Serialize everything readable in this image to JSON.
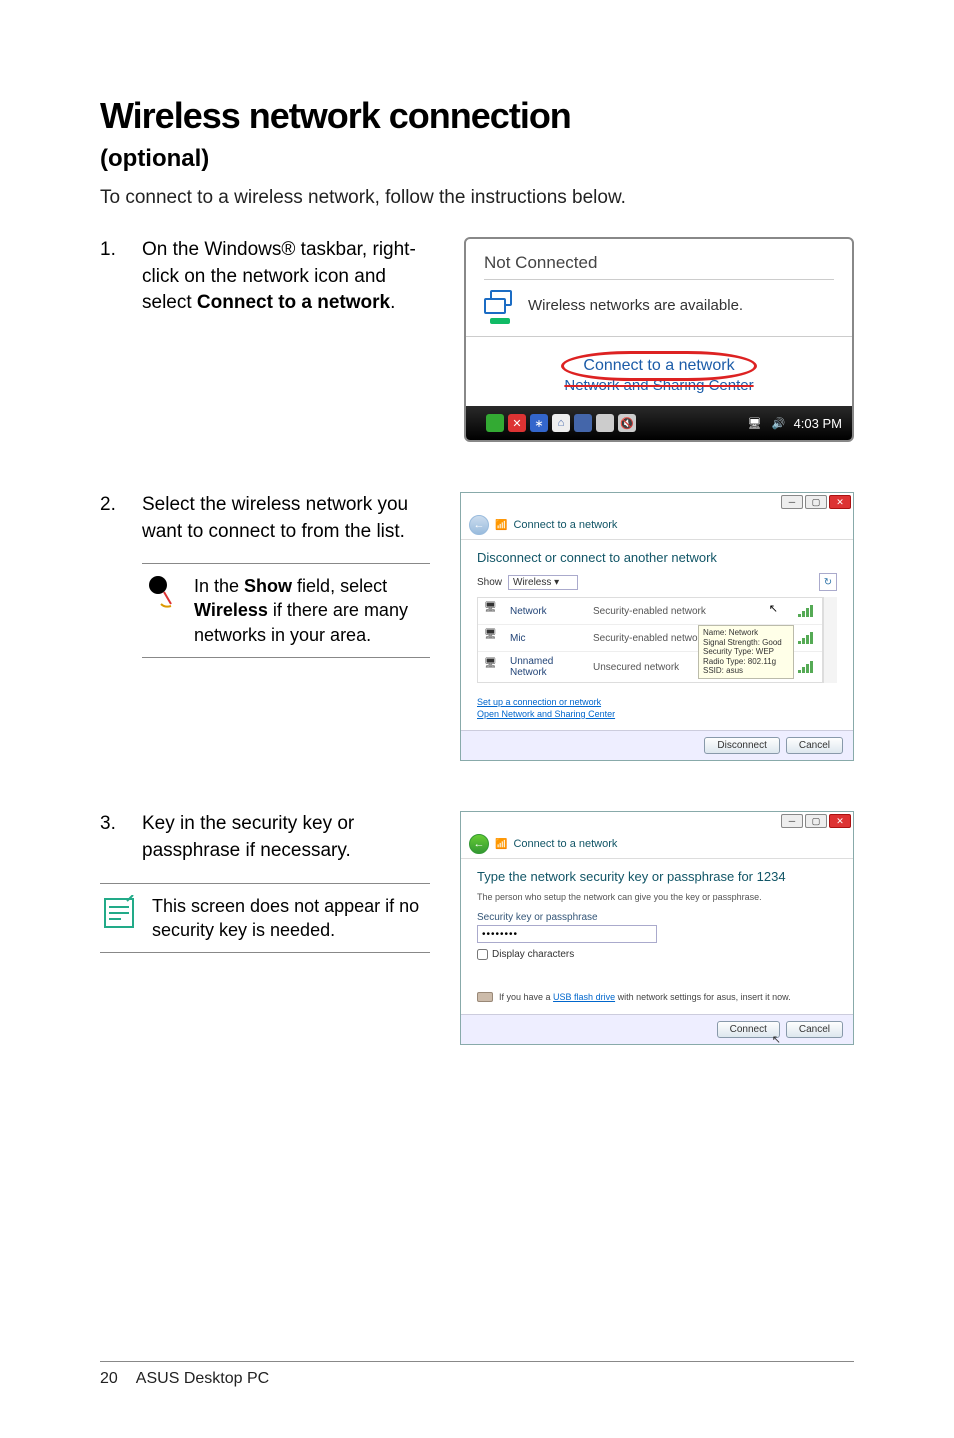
{
  "title": "Wireless network connection",
  "subtitle": "(optional)",
  "intro": "To connect to a wireless network, follow the instructions below.",
  "steps": [
    {
      "num": "1.",
      "text_parts": [
        "On the Windows® taskbar, right-click on the network icon and select ",
        "Connect to a network",
        "."
      ]
    },
    {
      "num": "2.",
      "text": "Select the wireless network you want to connect to from the list.",
      "note_parts": [
        "In the ",
        "Show",
        " field, select ",
        "Wireless",
        " if there are many networks in your area."
      ]
    },
    {
      "num": "3.",
      "text": "Key in the security key or passphrase if necessary.",
      "note": "This screen does not appear if no security key is needed."
    }
  ],
  "shot1": {
    "title": "Not Connected",
    "available": "Wireless networks are available.",
    "connect_link": "Connect to a network",
    "sharing_link": "Network and Sharing Center",
    "time": "4:03 PM"
  },
  "shot2": {
    "nav_title": "Connect to a network",
    "heading": "Disconnect or connect to another network",
    "show_label": "Show",
    "show_value": "Wireless",
    "rows": [
      {
        "name": "Network",
        "sec": "Security-enabled network"
      },
      {
        "name": "Mic",
        "sec": "Security-enabled network"
      },
      {
        "name": "Unnamed Network",
        "sec": "Unsecured network"
      }
    ],
    "tooltip": {
      "l1": "Name: Network",
      "l2": "Signal Strength: Good",
      "l3": "Security Type: WEP",
      "l4": "Radio Type: 802.11g",
      "l5": "SSID: asus"
    },
    "link1": "Set up a connection or network",
    "link2": "Open Network and Sharing Center",
    "btn_disconnect": "Disconnect",
    "btn_cancel": "Cancel"
  },
  "shot3": {
    "nav_title": "Connect to a network",
    "heading": "Type the network security key or passphrase for 1234",
    "sub": "The person who setup the network can give you the key or passphrase.",
    "field_label": "Security key or passphrase",
    "field_value": "••••••••",
    "display_chars": "Display characters",
    "usb_pre": "If you have a ",
    "usb_link": "USB flash drive",
    "usb_post": " with network settings for asus, insert it now.",
    "btn_connect": "Connect",
    "btn_cancel": "Cancel"
  },
  "footer": {
    "page": "20",
    "product": "ASUS Desktop PC"
  }
}
